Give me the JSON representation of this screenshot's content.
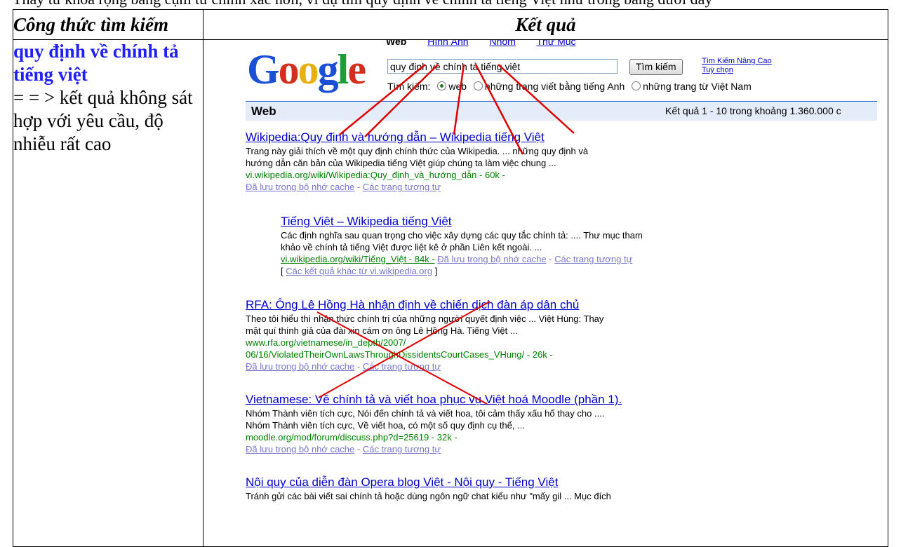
{
  "top_line": "Thay từ khóa rộng bằng cụm từ chính xác hơn, ví dụ tìm quy định về chính tả tiếng Việt như trong bảng dưới đây",
  "table": {
    "header_formula": "Công thức tìm kiếm",
    "header_result": "Kết quả",
    "query_title": "quy định về chính tả tiếng việt",
    "query_note": "= = > kết quả không sát hợp với yêu cầu, độ nhiễu rất cao"
  },
  "google": {
    "logo": [
      "G",
      "o",
      "o",
      "g",
      "l",
      "e"
    ],
    "nav": [
      "Web",
      "Hình Ảnh",
      "Nhóm",
      "Thư Mục"
    ],
    "search_value": "quy định về chính tả tiếng việt",
    "search_button": "Tìm kiếm",
    "advanced": [
      "Tìm Kiếm Nâng Cao",
      "Tuỳ chọn"
    ],
    "radio_label": "Tìm kiếm:",
    "radio_options": [
      "web",
      "những trang viết bằng tiếng Anh",
      "những trang từ Việt Nam"
    ],
    "web_label": "Web",
    "stats": "Kết quả 1 - 10 trong khoảng 1.360.000 c"
  },
  "results": [
    {
      "title": "Wikipedia:Quy định và hướng dẫn – Wikipedia tiếng Việt",
      "snippet1": "Trang này giải thích về một quy định chính thức của Wikipedia. ... những quy định và",
      "snippet2": "hướng dẫn căn bản của Wikipedia tiếng Việt giúp chúng ta làm việc chung ...",
      "url": "vi.wikipedia.org/wiki/Wikipedia:Quy_định_và_hướng_dẫn - 60k -",
      "cache": "Đã lưu trong bộ nhớ cache",
      "similar": "Các trang tương tự"
    },
    {
      "title": "Tiếng Việt – Wikipedia tiếng Việt",
      "snippet1": "Các định nghĩa sau quan trọng cho việc xây dựng các quy tắc chính tả: .... Thư mục tham",
      "snippet2": "khảo về chính tả tiếng Việt được liệt kê ở phần Liên kết ngoài. ...",
      "url": "vi.wikipedia.org/wiki/Tiếng_Việt - 84k -",
      "cache": "Đã lưu trong bộ nhớ cache",
      "similar": "Các trang tương tự",
      "more": "Các kết quả khác từ vi.wikipedia.org"
    },
    {
      "title": "RFA: Ông Lê Hồng Hà nhận định về chiến dịch đàn áp dân chủ",
      "snippet1": "Theo tôi hiểu thì nhận thức chính trị của những người quyết định việc ... Việt Hùng: Thay",
      "snippet2": "mặt quí thính giả của đài xin cám ơn ông Lê Hồng Hà. Tiếng Việt ...",
      "url1": "www.rfa.org/vietnamese/in_depth/2007/",
      "url2": "06/16/ViolatedTheirOwnLawsThroughDissidentsCourtCases_VHung/ - 26k -",
      "cache": "Đã lưu trong bộ nhớ cache",
      "similar": "Các trang tương tự"
    },
    {
      "title": "Vietnamese: Về chính tả và viết hoa phục vụ Việt hoá Moodle (phần 1).",
      "snippet1": "Nhóm Thành viên tích cực, Nói đến chính tả và viết hoa, tôi cảm thấy xấu hổ thay cho ....",
      "snippet2": "Nhóm Thành viên tích cực, Về viết hoa, có một số quy định cụ thể, ...",
      "url": "moodle.org/mod/forum/discuss.php?d=25619 - 32k -",
      "cache": "Đã lưu trong bộ nhớ cache",
      "similar": "Các trang tương tự"
    },
    {
      "title": "Nội quy của diễn đàn Opera blog Việt - Nội quy - Tiếng Việt",
      "snippet1": "Tránh gửi các bài viết sai chính tả hoặc dùng ngôn ngữ chat kiểu như \"mấy gil ... Mục đích"
    }
  ],
  "colors": {
    "query_blue": "#1f1fff",
    "link_blue": "#0000cc",
    "url_green": "#008000",
    "annotation_red": "#e00000"
  }
}
